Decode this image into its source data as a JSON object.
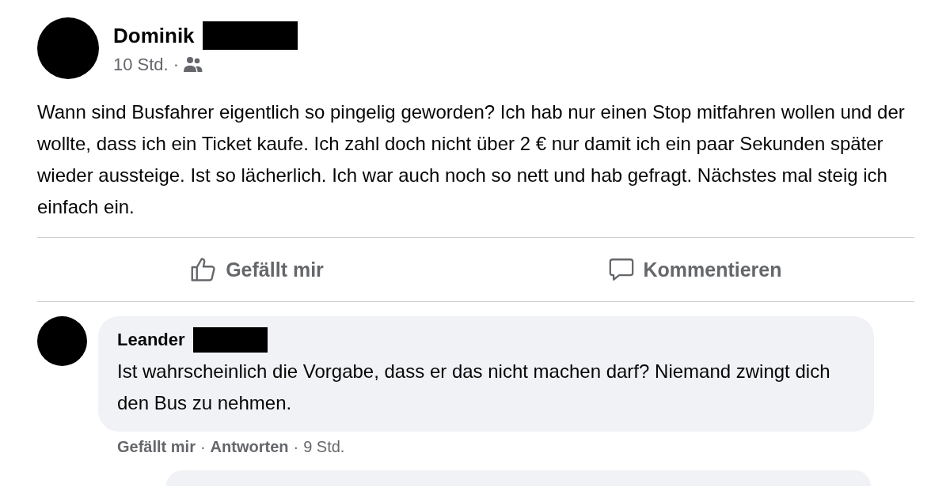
{
  "post": {
    "author": {
      "name": "Dominik",
      "redacted": true
    },
    "time": "10 Std.",
    "separator": "·",
    "body": "Wann sind Busfahrer eigentlich so pingelig geworden? Ich hab nur einen Stop mitfahren wollen und der wollte, dass ich ein Ticket kaufe. Ich zahl doch nicht über 2 € nur damit ich ein paar Sekunden später wieder aussteige. Ist so lächerlich. Ich war auch noch so nett und hab gefragt. Nächstes mal steig ich einfach ein.",
    "actions": [
      {
        "kind": "like",
        "label": "Gefällt mir"
      },
      {
        "kind": "comment",
        "label": "Kommentieren"
      }
    ]
  },
  "comments": [
    {
      "author": {
        "name": "Leander",
        "redacted": true
      },
      "text": "Ist wahrscheinlich die Vorgabe, dass er das nicht machen darf? Niemand zwingt dich den Bus zu nehmen.",
      "actions": [
        {
          "kind": "link",
          "label": "Gefällt mir"
        },
        {
          "kind": "separator",
          "label": "·"
        },
        {
          "kind": "link",
          "label": "Antworten"
        },
        {
          "kind": "separator",
          "label": "·"
        },
        {
          "kind": "time",
          "label": "9 Std."
        }
      ]
    }
  ]
}
